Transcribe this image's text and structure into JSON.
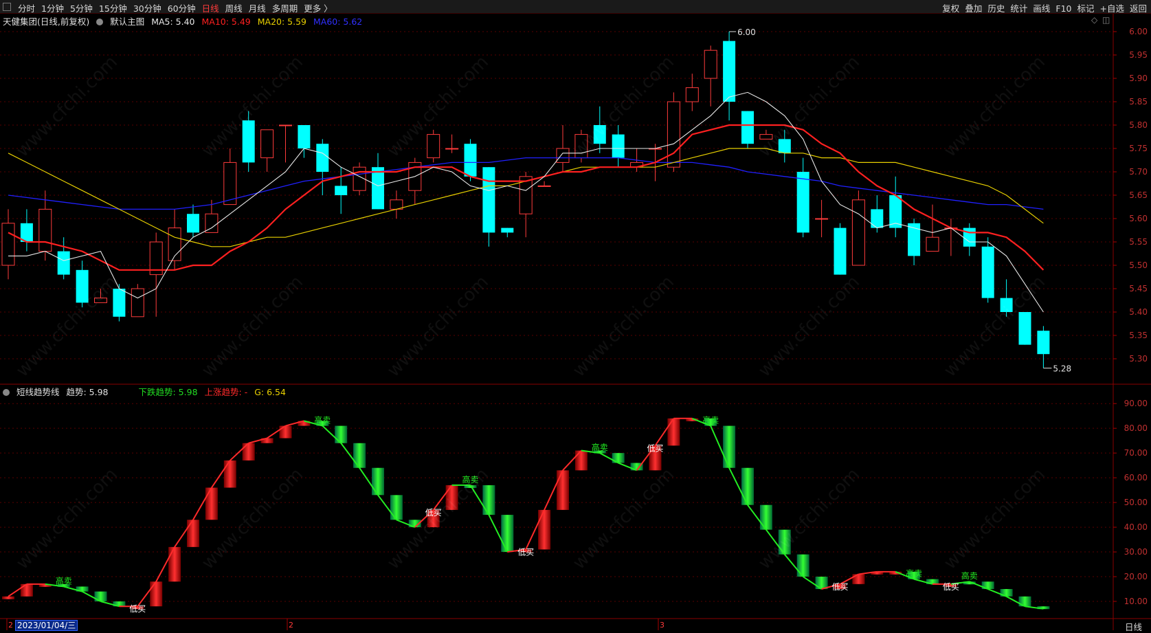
{
  "toolbar": {
    "periods": [
      "分时",
      "1分钟",
      "5分钟",
      "15分钟",
      "30分钟",
      "60分钟",
      "日线",
      "周线",
      "月线",
      "多周期",
      "更多 〉"
    ],
    "active": "日线",
    "right": [
      "复权",
      "叠加",
      "历史",
      "统计",
      "画线",
      "F10",
      "标记",
      "+自选",
      "返回"
    ]
  },
  "main_legend": {
    "stock": "天健集团(日线,前复权)",
    "indicator": "默认主图",
    "ma5": "MA5: 5.40",
    "ma10": "MA10: 5.49",
    "ma20": "MA20: 5.59",
    "ma60": "MA60: 5.62"
  },
  "sub_legend": {
    "name": "短线趋势线",
    "trend": "趋势: 5.98",
    "down": "下跌趋势: 5.98",
    "up": "上涨趋势: -",
    "g": "G: 6.54"
  },
  "high_label": "6.00",
  "low_label": "5.28",
  "date_label": "2023/01/04/三",
  "month_marks": [
    "2",
    "2",
    "3"
  ],
  "period_foot": "日线",
  "watermark": "www.cfchi.com",
  "colors": {
    "up": "#ff3b3b",
    "down": "#00ffff",
    "ma5": "#e8e8e8",
    "ma10": "#ff2020",
    "ma20": "#e8d000",
    "ma60": "#2020ff",
    "green": "#22dd22",
    "red": "#ff2a2a"
  },
  "chart_data": [
    {
      "type": "candlestick",
      "ylim": [
        5.26,
        6.02
      ],
      "yticks": [
        5.3,
        5.35,
        5.4,
        5.45,
        5.5,
        5.55,
        5.6,
        5.65,
        5.7,
        5.75,
        5.8,
        5.85,
        5.9,
        5.95,
        6.0
      ],
      "candles": [
        [
          5.5,
          5.59,
          5.62,
          5.47
        ],
        [
          5.59,
          5.55,
          5.62,
          5.53
        ],
        [
          5.53,
          5.62,
          5.66,
          5.51
        ],
        [
          5.53,
          5.48,
          5.56,
          5.47
        ],
        [
          5.49,
          5.42,
          5.51,
          5.41
        ],
        [
          5.42,
          5.43,
          5.45,
          5.42
        ],
        [
          5.45,
          5.39,
          5.46,
          5.38
        ],
        [
          5.39,
          5.45,
          5.46,
          5.39
        ],
        [
          5.48,
          5.55,
          5.57,
          5.39
        ],
        [
          5.51,
          5.58,
          5.62,
          5.49
        ],
        [
          5.61,
          5.57,
          5.63,
          5.56
        ],
        [
          5.57,
          5.61,
          5.64,
          5.57
        ],
        [
          5.63,
          5.72,
          5.75,
          5.63
        ],
        [
          5.81,
          5.72,
          5.83,
          5.7
        ],
        [
          5.73,
          5.79,
          5.79,
          5.7
        ],
        [
          5.8,
          5.8,
          5.8,
          5.72
        ],
        [
          5.8,
          5.75,
          5.8,
          5.73
        ],
        [
          5.76,
          5.7,
          5.77,
          5.65
        ],
        [
          5.67,
          5.65,
          5.71,
          5.61
        ],
        [
          5.66,
          5.71,
          5.72,
          5.65
        ],
        [
          5.71,
          5.62,
          5.74,
          5.62
        ],
        [
          5.62,
          5.64,
          5.66,
          5.6
        ],
        [
          5.66,
          5.72,
          5.73,
          5.63
        ],
        [
          5.73,
          5.78,
          5.79,
          5.72
        ],
        [
          5.75,
          5.75,
          5.78,
          5.74
        ],
        [
          5.76,
          5.69,
          5.77,
          5.68
        ],
        [
          5.71,
          5.57,
          5.71,
          5.54
        ],
        [
          5.58,
          5.57,
          5.58,
          5.56
        ],
        [
          5.61,
          5.69,
          5.7,
          5.56
        ],
        [
          5.67,
          5.67,
          5.68,
          5.67
        ],
        [
          5.72,
          5.75,
          5.8,
          5.7
        ],
        [
          5.73,
          5.78,
          5.79,
          5.72
        ],
        [
          5.8,
          5.76,
          5.84,
          5.74
        ],
        [
          5.78,
          5.73,
          5.8,
          5.71
        ],
        [
          5.71,
          5.72,
          5.75,
          5.7
        ],
        [
          5.75,
          5.75,
          5.76,
          5.68
        ],
        [
          5.71,
          5.85,
          5.87,
          5.7
        ],
        [
          5.85,
          5.88,
          5.91,
          5.83
        ],
        [
          5.9,
          5.96,
          5.97,
          5.84
        ],
        [
          5.98,
          5.85,
          6.0,
          5.81
        ],
        [
          5.83,
          5.76,
          5.83,
          5.75
        ],
        [
          5.77,
          5.78,
          5.79,
          5.77
        ],
        [
          5.77,
          5.74,
          5.79,
          5.72
        ],
        [
          5.7,
          5.57,
          5.73,
          5.56
        ],
        [
          5.6,
          5.6,
          5.64,
          5.56
        ],
        [
          5.58,
          5.48,
          5.59,
          5.48
        ],
        [
          5.5,
          5.64,
          5.66,
          5.5
        ],
        [
          5.62,
          5.58,
          5.65,
          5.57
        ],
        [
          5.65,
          5.58,
          5.69,
          5.56
        ],
        [
          5.59,
          5.52,
          5.6,
          5.5
        ],
        [
          5.53,
          5.56,
          5.63,
          5.53
        ],
        [
          5.58,
          5.58,
          5.6,
          5.52
        ],
        [
          5.58,
          5.54,
          5.59,
          5.52
        ],
        [
          5.54,
          5.43,
          5.56,
          5.42
        ],
        [
          5.43,
          5.4,
          5.47,
          5.39
        ],
        [
          5.4,
          5.33,
          5.4,
          5.33
        ],
        [
          5.36,
          5.31,
          5.37,
          5.28
        ]
      ],
      "ma5": [
        5.52,
        5.52,
        5.53,
        5.51,
        5.52,
        5.53,
        5.45,
        5.43,
        5.45,
        5.52,
        5.56,
        5.58,
        5.61,
        5.64,
        5.67,
        5.7,
        5.75,
        5.74,
        5.71,
        5.69,
        5.67,
        5.68,
        5.69,
        5.71,
        5.7,
        5.67,
        5.66,
        5.67,
        5.66,
        5.69,
        5.74,
        5.74,
        5.75,
        5.75,
        5.75,
        5.75,
        5.76,
        5.79,
        5.82,
        5.86,
        5.87,
        5.85,
        5.82,
        5.77,
        5.68,
        5.63,
        5.61,
        5.58,
        5.59,
        5.58,
        5.57,
        5.58,
        5.55,
        5.55,
        5.52,
        5.46,
        5.4
      ],
      "ma10": [
        5.57,
        5.55,
        5.55,
        5.54,
        5.53,
        5.51,
        5.49,
        5.49,
        5.49,
        5.49,
        5.5,
        5.5,
        5.53,
        5.55,
        5.58,
        5.62,
        5.65,
        5.68,
        5.69,
        5.7,
        5.7,
        5.7,
        5.71,
        5.71,
        5.71,
        5.69,
        5.68,
        5.68,
        5.68,
        5.69,
        5.7,
        5.7,
        5.71,
        5.71,
        5.71,
        5.72,
        5.74,
        5.78,
        5.79,
        5.8,
        5.8,
        5.8,
        5.8,
        5.79,
        5.76,
        5.74,
        5.7,
        5.67,
        5.65,
        5.62,
        5.6,
        5.58,
        5.57,
        5.57,
        5.56,
        5.53,
        5.49
      ],
      "ma20": [
        5.74,
        5.72,
        5.7,
        5.68,
        5.66,
        5.64,
        5.62,
        5.6,
        5.58,
        5.56,
        5.55,
        5.54,
        5.54,
        5.55,
        5.56,
        5.56,
        5.57,
        5.58,
        5.59,
        5.6,
        5.61,
        5.62,
        5.63,
        5.64,
        5.65,
        5.66,
        5.67,
        5.67,
        5.68,
        5.69,
        5.7,
        5.71,
        5.71,
        5.71,
        5.71,
        5.71,
        5.72,
        5.73,
        5.74,
        5.75,
        5.75,
        5.75,
        5.74,
        5.74,
        5.73,
        5.73,
        5.72,
        5.72,
        5.72,
        5.71,
        5.7,
        5.69,
        5.68,
        5.67,
        5.65,
        5.62,
        5.59
      ],
      "ma60": [
        5.65,
        5.645,
        5.64,
        5.635,
        5.63,
        5.625,
        5.62,
        5.62,
        5.62,
        5.62,
        5.625,
        5.63,
        5.64,
        5.65,
        5.66,
        5.67,
        5.68,
        5.685,
        5.69,
        5.695,
        5.7,
        5.705,
        5.71,
        5.715,
        5.72,
        5.72,
        5.72,
        5.725,
        5.73,
        5.73,
        5.73,
        5.73,
        5.73,
        5.73,
        5.725,
        5.72,
        5.72,
        5.72,
        5.715,
        5.71,
        5.7,
        5.695,
        5.69,
        5.685,
        5.68,
        5.67,
        5.665,
        5.66,
        5.655,
        5.65,
        5.645,
        5.64,
        5.635,
        5.63,
        5.63,
        5.625,
        5.62
      ]
    },
    {
      "type": "trend",
      "ylim": [
        5,
        92
      ],
      "yticks": [
        10,
        20,
        30,
        40,
        50,
        60,
        70,
        80,
        90
      ],
      "values": [
        12,
        17,
        17,
        16,
        14,
        10,
        8,
        8,
        18,
        32,
        43,
        56,
        67,
        74,
        76,
        81,
        83,
        81,
        74,
        64,
        53,
        43,
        40,
        47,
        57,
        57,
        45,
        30,
        31,
        47,
        63,
        71,
        70,
        66,
        63,
        73,
        84,
        84,
        81,
        64,
        49,
        39,
        29,
        20,
        15,
        17,
        21,
        22,
        22,
        19,
        17,
        17,
        18,
        15,
        12,
        8,
        7
      ],
      "trend": [
        "u",
        "u",
        "u",
        "d",
        "d",
        "d",
        "d",
        "u",
        "u",
        "u",
        "u",
        "u",
        "u",
        "u",
        "u",
        "u",
        "u",
        "d",
        "d",
        "d",
        "d",
        "d",
        "d",
        "u",
        "u",
        "d",
        "d",
        "d",
        "u",
        "u",
        "u",
        "u",
        "d",
        "d",
        "d",
        "u",
        "u",
        "u",
        "d",
        "d",
        "d",
        "d",
        "d",
        "d",
        "d",
        "u",
        "u",
        "u",
        "u",
        "d",
        "d",
        "u",
        "d",
        "d",
        "d",
        "d",
        "d"
      ],
      "signals": [
        {
          "i": 3,
          "text": "高卖"
        },
        {
          "i": 7,
          "text": "低买"
        },
        {
          "i": 17,
          "text": "高卖"
        },
        {
          "i": 23,
          "text": "低买"
        },
        {
          "i": 25,
          "text": "高卖"
        },
        {
          "i": 28,
          "text": "低买"
        },
        {
          "i": 32,
          "text": "高卖"
        },
        {
          "i": 35,
          "text": "低买"
        },
        {
          "i": 38,
          "text": "高卖"
        },
        {
          "i": 45,
          "text": "低买"
        },
        {
          "i": 49,
          "text": "高卖"
        },
        {
          "i": 51,
          "text": "低买"
        },
        {
          "i": 52,
          "text": "高卖"
        }
      ]
    }
  ]
}
